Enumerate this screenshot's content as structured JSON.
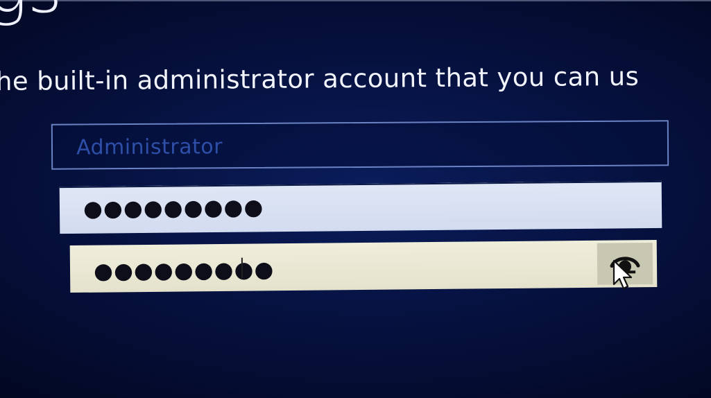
{
  "screen": {
    "heading_fragment": "gs",
    "description": "he built-in administrator account that you can us"
  },
  "form": {
    "username": {
      "value": "Administrator"
    },
    "password": {
      "masked_value": "●●●●●●●●●"
    },
    "confirm_password": {
      "masked_value": "●●●●●●●●●",
      "reveal_icon": "eye-icon"
    }
  },
  "pointer": {
    "icon": "mouse-pointer-icon"
  },
  "colors": {
    "background": "#06113f",
    "text": "#f2f4fb",
    "username_text": "#2e4fa8",
    "field_border": "#6b83c4"
  }
}
